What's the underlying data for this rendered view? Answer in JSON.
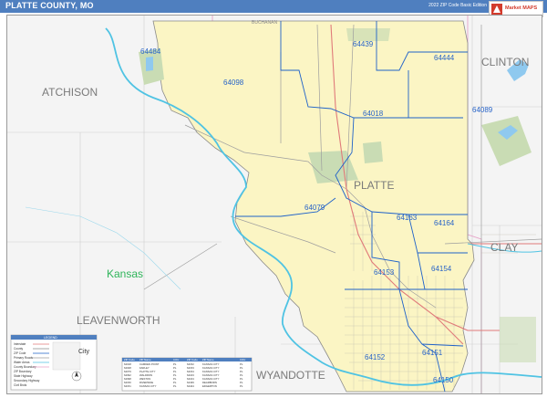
{
  "header": {
    "title": "PLATTE COUNTY, MO",
    "edition": "2022 ZIP Code Basic Edition",
    "logo_text": "Market MAPS"
  },
  "map": {
    "county_names": [
      "ATCHISON",
      "LEAVENWORTH",
      "WYANDOTTE",
      "CLINTON",
      "CLAY",
      "PLATTE"
    ],
    "state_label": "Kansas",
    "highway_label": "BUCHANAN",
    "zip_codes": [
      "64484",
      "64439",
      "64444",
      "64098",
      "64018",
      "64089",
      "64079",
      "64163",
      "64164",
      "64153",
      "64154",
      "64152",
      "64151",
      "64150"
    ]
  },
  "legend": {
    "title": "LEGEND",
    "entries": [
      "Interstate",
      "County",
      "ZIP Code",
      "Primary Roads",
      "Water Areas",
      "County Boundary",
      "ZIP Boundary",
      "State Highway",
      "Secondary Highway",
      "Civil Bnds"
    ],
    "city_label": "City"
  },
  "zip_table": {
    "headers": [
      "ZIP Code",
      "ZIP Name",
      "COU"
    ],
    "rows": [
      [
        "64018",
        "CAMDEN POINT",
        "PL"
      ],
      [
        "64028",
        "FARLEY",
        "PL"
      ],
      [
        "64079",
        "PLATTE CITY",
        "PL"
      ],
      [
        "64092",
        "WALDRON",
        "PL"
      ],
      [
        "64098",
        "WESTON",
        "PL"
      ],
      [
        "64150",
        "RIVERSIDE",
        "PL"
      ],
      [
        "64151",
        "KANSAS CITY",
        "PL"
      ]
    ],
    "rows_b": [
      [
        "64152",
        "KANSAS CITY",
        "PL"
      ],
      [
        "64153",
        "KANSAS CITY",
        "PL"
      ],
      [
        "64154",
        "KANSAS CITY",
        "PL"
      ],
      [
        "64163",
        "KANSAS CITY",
        "PL"
      ],
      [
        "64164",
        "KANSAS CITY",
        "PL"
      ],
      [
        "64439",
        "DEARBORN",
        "PL"
      ],
      [
        "64444",
        "EDGERTON",
        "PL"
      ]
    ]
  },
  "colors": {
    "header_bg": "#4f7fbf",
    "county_fill": "#fbf5c4",
    "river": "#4fc3e3",
    "zip_boundary": "#1f62c9",
    "zip_label": "#2864c8",
    "county_label": "#7a7a7a",
    "state_label": "#2fb45a",
    "park": "#c9dcb4",
    "lake": "#8fc9ef"
  }
}
